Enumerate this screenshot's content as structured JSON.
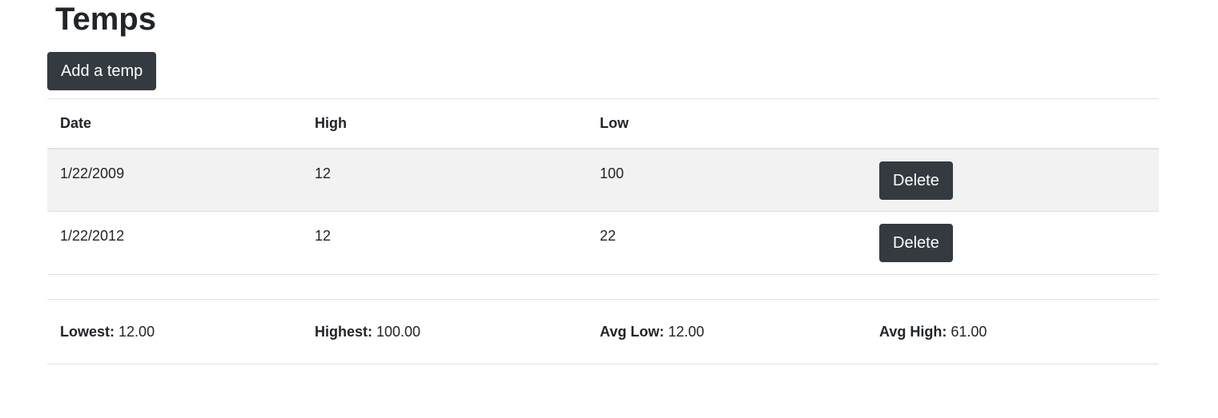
{
  "page": {
    "title": "Temps"
  },
  "toolbar": {
    "add_label": "Add a temp"
  },
  "table": {
    "columns": [
      "Date",
      "High",
      "Low",
      ""
    ],
    "rows": [
      {
        "date": "1/22/2009",
        "high": "12",
        "low": "100",
        "action": "Delete"
      },
      {
        "date": "1/22/2012",
        "high": "12",
        "low": "22",
        "action": "Delete"
      }
    ]
  },
  "summary": {
    "lowest_label": "Lowest:",
    "lowest_value": "12.00",
    "highest_label": "Highest:",
    "highest_value": "100.00",
    "avg_low_label": "Avg Low:",
    "avg_low_value": "12.00",
    "avg_high_label": "Avg High:",
    "avg_high_value": "61.00"
  },
  "colors": {
    "button_bg": "#343a40",
    "stripe_bg": "#f2f2f2",
    "border": "#dee2e6",
    "text": "#212529"
  }
}
